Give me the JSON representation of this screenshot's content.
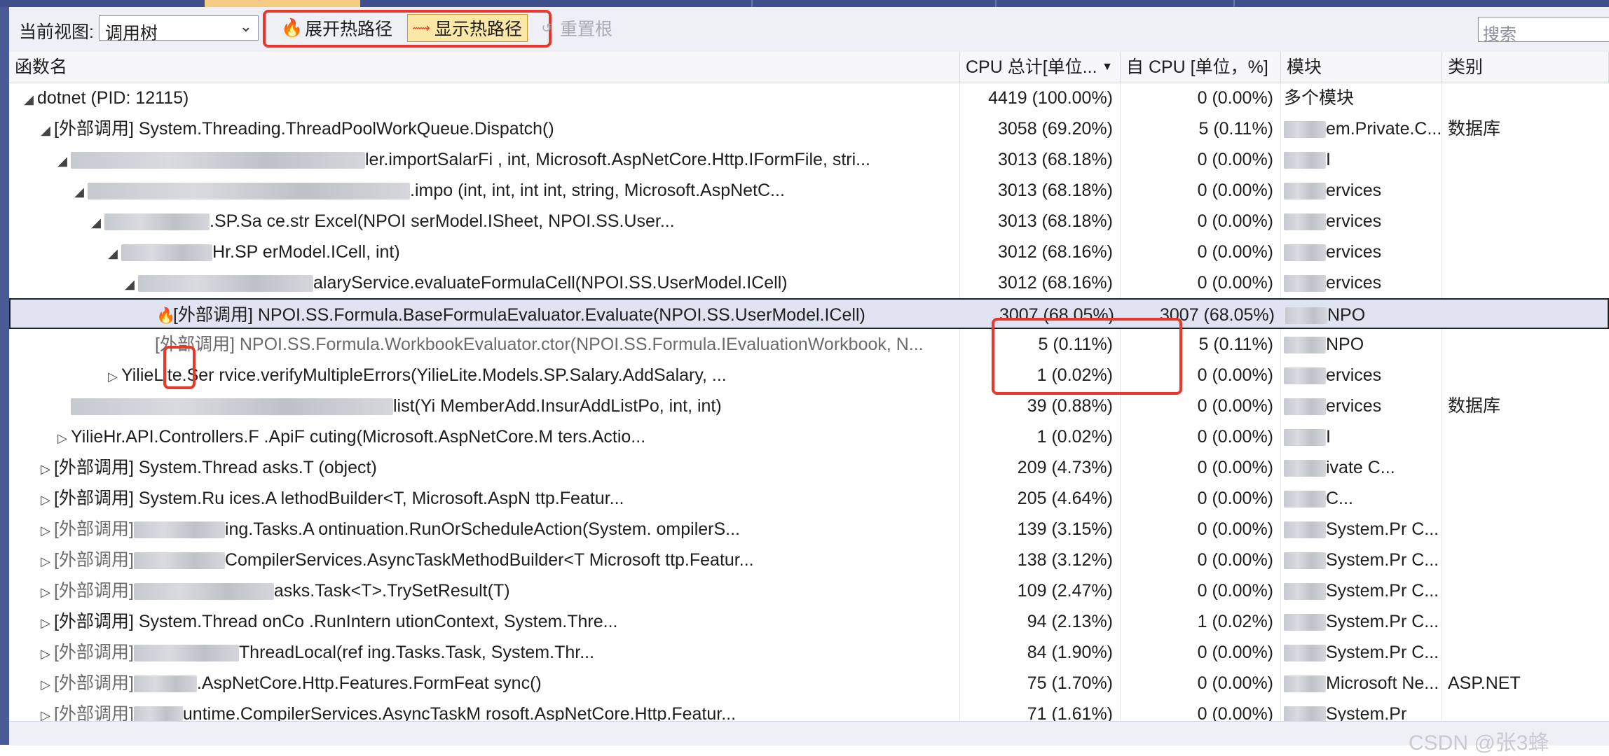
{
  "toolbar": {
    "view_label": "当前视图:",
    "view_value": "调用树",
    "expand_hot_path": "展开热路径",
    "show_hot_path": "显示热路径",
    "reset_root": "重置根",
    "search_placeholder": "搜索"
  },
  "columns": {
    "name": "函数名",
    "total_cpu": "CPU 总计[单位...",
    "self_cpu": "自 CPU [单位，%]",
    "module": "模块",
    "category": "类别"
  },
  "rows": [
    {
      "name": "dotnet (PID: 12115)",
      "total": "4419 (100.00%)",
      "self": "0 (0.00%)",
      "module": "多个模块",
      "category": ""
    },
    {
      "name": "[外部调用] System.Threading.ThreadPoolWorkQueue.Dispatch()",
      "total": "3058 (69.20%)",
      "self": "5 (0.11%)",
      "module": "em.Private.C...",
      "category": "数据库"
    },
    {
      "name": "ler.importSalarFi     , int, Microsoft.AspNetCore.Http.IFormFile, stri...",
      "total": "3013 (68.18%)",
      "self": "0 (0.00%)",
      "module": "I",
      "category": ""
    },
    {
      "name": ".impo            (int, int, int     int, string, Microsoft.AspNetC...",
      "total": "3013 (68.18%)",
      "self": "0 (0.00%)",
      "module": "ervices",
      "category": ""
    },
    {
      "name": ".SP.Sa          ce.str              Excel(NPOI      serModel.ISheet, NPOI.SS.User...",
      "total": "3013 (68.18%)",
      "self": "0 (0.00%)",
      "module": "ervices",
      "category": ""
    },
    {
      "name": "Hr.SP                                 erModel.ICell, int)",
      "total": "3012 (68.16%)",
      "self": "0 (0.00%)",
      "module": "ervices",
      "category": ""
    },
    {
      "name": "alaryService.evaluateFormulaCell(NPOI.SS.UserModel.ICell)",
      "total": "3012 (68.16%)",
      "self": "0 (0.00%)",
      "module": "ervices",
      "category": ""
    },
    {
      "name": "[外部调用] NPOI.SS.Formula.BaseFormulaEvaluator.Evaluate(NPOI.SS.UserModel.ICell)",
      "total": "3007 (68.05%)",
      "self": "3007 (68.05%)",
      "module": "NPO",
      "category": ""
    },
    {
      "name": "[外部调用] NPOI.SS.Formula.WorkbookEvaluator.ctor(NPOI.SS.Formula.IEvaluationWorkbook, N...",
      "total": "5 (0.11%)",
      "self": "5 (0.11%)",
      "module": "NPO",
      "category": ""
    },
    {
      "name": "YilieLite.Ser                    rvice.verifyMultipleErrors(YilieLite.Models.SP.Salary.AddSalary, ...",
      "total": "1 (0.02%)",
      "self": "0 (0.00%)",
      "module": "ervices",
      "category": ""
    },
    {
      "name": "list(Yi                          MemberAdd.InsurAddListPo, int, int)",
      "total": "39 (0.88%)",
      "self": "0 (0.00%)",
      "module": "ervices",
      "category": "数据库"
    },
    {
      "name": "YilieHr.API.Controllers.F     .ApiF                           cuting(Microsoft.AspNetCore.M        ters.Actio...",
      "total": "1 (0.02%)",
      "self": "0 (0.00%)",
      "module": "I",
      "category": ""
    },
    {
      "name": "[外部调用] System.Thread       asks.T                   (object)",
      "total": "209 (4.73%)",
      "self": "0 (0.00%)",
      "module": "ivate C...",
      "category": ""
    },
    {
      "name": "[外部调用] System.Ru                  ices.A              lethodBuilder<T, Microsoft.AspN          ttp.Featur...",
      "total": "205 (4.64%)",
      "self": "0 (0.00%)",
      "module": "C...",
      "category": ""
    },
    {
      "name": "ing.Tasks.A              ontinuation.RunOrScheduleAction(System.          ompilerS...",
      "total": "139 (3.15%)",
      "self": "0 (0.00%)",
      "module": "System.Pr       C...",
      "category": ""
    },
    {
      "name": "CompilerServices.AsyncTaskMethodBuilder<T   Microsoft        ttp.Featur...",
      "total": "138 (3.12%)",
      "self": "0 (0.00%)",
      "module": "System.Pr       C...",
      "category": ""
    },
    {
      "name": "asks.Task<T>.TrySetResult(T)",
      "total": "109 (2.47%)",
      "self": "0 (0.00%)",
      "module": "System.Pr       C...",
      "category": ""
    },
    {
      "name": "[外部调用] System.Thread                onCo        .RunIntern                           utionContext, System.Thre...",
      "total": "94 (2.13%)",
      "self": "1 (0.02%)",
      "module": "System.Pr       C...",
      "category": ""
    },
    {
      "name": "ThreadLocal(ref                      ing.Tasks.Task, System.Thr...",
      "total": "84 (1.90%)",
      "self": "0 (0.00%)",
      "module": "System.Pr       C...",
      "category": ""
    },
    {
      "name": ".AspNetCore.Http.Features.FormFeat        sync()",
      "total": "75 (1.70%)",
      "self": "0 (0.00%)",
      "module": "Microsoft    Ne...",
      "category": "ASP.NET"
    },
    {
      "name": "untime.CompilerServices.AsyncTaskM                  rosoft.AspNetCore.Http.Featur...",
      "total": "71 (1.61%)",
      "self": "0 (0.00%)",
      "module": "System.Pr",
      "category": ""
    }
  ],
  "labels": {
    "external_call": "[外部调用]",
    "yilie_prefix": "Yilie",
    "module_prefix": "Yilie"
  },
  "watermark": "CSDN @张3蜂",
  "icons": {
    "flame": "flame-icon",
    "hot-path": "hot-path-icon",
    "reset": "reset-root-icon"
  }
}
